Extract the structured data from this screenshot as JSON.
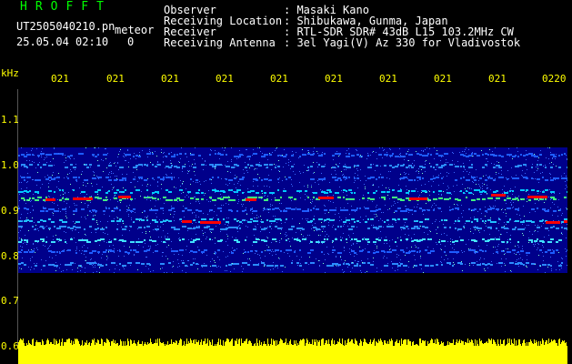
{
  "header": {
    "title": "HROFFT",
    "filename": "UT2505040210.pn",
    "meteor_label": "meteor",
    "date_time": "25.05.04 02:10",
    "count": "0",
    "info": [
      {
        "label": "Observer",
        "value": ": Masaki Kano"
      },
      {
        "label": "Receiving Location",
        "value": ": Shibukawa, Gunma, Japan"
      },
      {
        "label": "Receiver",
        "value": ": RTL-SDR SDR# 43dB L15 103.2MHz CW"
      },
      {
        "label": "Receiving Antenna",
        "value": ": 3el Yagi(V) Az 330 for Vladivostok"
      }
    ]
  },
  "axis": {
    "unit": "kHz",
    "y_labels": [
      "1.1",
      "1.0",
      "0.9",
      "0.8",
      "0.7",
      "0.6"
    ],
    "time_ticks": [
      "021",
      "021",
      "021",
      "021",
      "021",
      "021",
      "021",
      "021",
      "021",
      "0220"
    ]
  },
  "colors": {
    "signal_band": "#0000ff",
    "meteor_trace": "#ff0000",
    "level_bar": "#ffff00",
    "axis_text": "#ffff00",
    "title_text": "#00ff00"
  }
}
